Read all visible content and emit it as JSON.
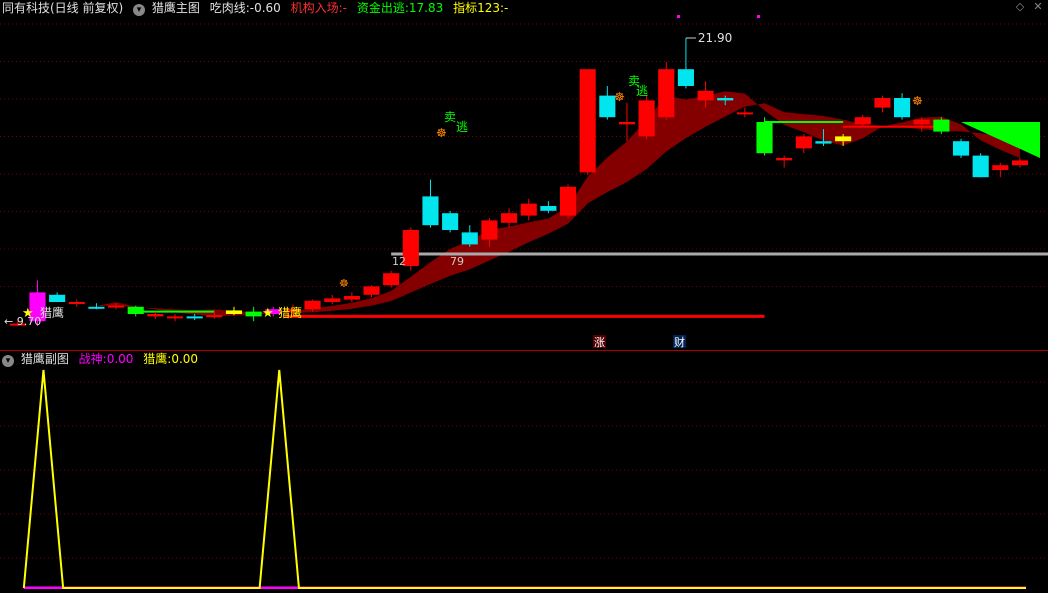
{
  "header": {
    "stock": "同有科技(日线 前复权)",
    "main_title": "猎鹰主图",
    "chirou_label": "吃肉线:",
    "chirou_value": "-0.60",
    "jigou_label": "机构入场:",
    "jigou_value": "-",
    "zijin_label": "资金出逃:",
    "zijin_value": "17.83",
    "zhibiao_label": "指标123:",
    "zhibiao_value": "-"
  },
  "sub_header": {
    "title": "猎鹰副图",
    "zhanshen_label": "战神:",
    "zhanshen_value": "0.00",
    "lieying_label": "猎鹰:",
    "lieying_value": "0.00"
  },
  "annotations": {
    "high": "21.90",
    "low": "9.70",
    "mid_left": "12",
    "mid_right": "79",
    "falcon1": "猎鹰",
    "falcon2": "猎鹰",
    "sell1": "卖",
    "escape1": "逃",
    "sell2": "卖",
    "escape2": "逃",
    "badge_zhang": "涨",
    "badge_cai": "财"
  },
  "colors": {
    "up": "#ff0000",
    "down": "#00e5ee",
    "band": "#8b0000",
    "green": "#00ff00",
    "yellow": "#ffff00",
    "magenta": "#ff00ff",
    "grid": "#7a0000"
  },
  "chart_data": {
    "type": "candlestick",
    "price_range": [
      9.7,
      21.9
    ],
    "candles": [
      {
        "o": 10.0,
        "h": 10.1,
        "l": 9.9,
        "c": 9.95,
        "color": "up"
      },
      {
        "o": 10.1,
        "h": 11.8,
        "l": 9.9,
        "c": 11.3,
        "color": "magenta"
      },
      {
        "o": 11.2,
        "h": 11.3,
        "l": 10.9,
        "c": 10.9,
        "color": "down"
      },
      {
        "o": 10.9,
        "h": 11.0,
        "l": 10.7,
        "c": 10.85,
        "color": "up"
      },
      {
        "o": 10.7,
        "h": 10.85,
        "l": 10.6,
        "c": 10.7,
        "color": "down"
      },
      {
        "o": 10.75,
        "h": 10.85,
        "l": 10.6,
        "c": 10.7,
        "color": "up"
      },
      {
        "o": 10.7,
        "h": 10.75,
        "l": 10.3,
        "c": 10.4,
        "color": "green"
      },
      {
        "o": 10.4,
        "h": 10.5,
        "l": 10.2,
        "c": 10.3,
        "color": "up"
      },
      {
        "o": 10.3,
        "h": 10.4,
        "l": 10.1,
        "c": 10.25,
        "color": "up"
      },
      {
        "o": 10.3,
        "h": 10.4,
        "l": 10.15,
        "c": 10.25,
        "color": "down"
      },
      {
        "o": 10.35,
        "h": 10.5,
        "l": 10.2,
        "c": 10.3,
        "color": "up"
      },
      {
        "o": 10.4,
        "h": 10.7,
        "l": 10.35,
        "c": 10.55,
        "color": "yellow"
      },
      {
        "o": 10.3,
        "h": 10.7,
        "l": 10.1,
        "c": 10.5,
        "color": "green"
      },
      {
        "o": 10.4,
        "h": 10.7,
        "l": 10.3,
        "c": 10.6,
        "color": "magenta"
      },
      {
        "o": 10.5,
        "h": 10.8,
        "l": 10.4,
        "c": 10.6,
        "color": "up"
      },
      {
        "o": 10.6,
        "h": 11.0,
        "l": 10.5,
        "c": 10.95,
        "color": "up"
      },
      {
        "o": 10.9,
        "h": 11.2,
        "l": 10.8,
        "c": 11.05,
        "color": "up"
      },
      {
        "o": 11.0,
        "h": 11.3,
        "l": 10.9,
        "c": 11.15,
        "color": "up"
      },
      {
        "o": 11.2,
        "h": 11.6,
        "l": 11.1,
        "c": 11.55,
        "color": "up"
      },
      {
        "o": 11.6,
        "h": 12.2,
        "l": 11.5,
        "c": 12.1,
        "color": "up"
      },
      {
        "o": 12.4,
        "h": 14.0,
        "l": 12.2,
        "c": 13.9,
        "color": "up"
      },
      {
        "o": 15.3,
        "h": 16.0,
        "l": 14.0,
        "c": 14.1,
        "color": "down"
      },
      {
        "o": 14.6,
        "h": 14.7,
        "l": 13.8,
        "c": 13.9,
        "color": "down"
      },
      {
        "o": 13.8,
        "h": 14.1,
        "l": 13.2,
        "c": 13.3,
        "color": "down"
      },
      {
        "o": 13.5,
        "h": 14.4,
        "l": 13.2,
        "c": 14.3,
        "color": "up"
      },
      {
        "o": 14.2,
        "h": 14.8,
        "l": 14.0,
        "c": 14.6,
        "color": "up"
      },
      {
        "o": 14.5,
        "h": 15.2,
        "l": 14.3,
        "c": 15.0,
        "color": "up"
      },
      {
        "o": 14.9,
        "h": 15.1,
        "l": 14.6,
        "c": 14.7,
        "color": "down"
      },
      {
        "o": 14.5,
        "h": 15.8,
        "l": 14.4,
        "c": 15.7,
        "color": "up"
      },
      {
        "o": 16.3,
        "h": 20.6,
        "l": 16.2,
        "c": 20.6,
        "color": "up"
      },
      {
        "o": 19.5,
        "h": 19.9,
        "l": 18.5,
        "c": 18.6,
        "color": "down"
      },
      {
        "o": 18.4,
        "h": 19.2,
        "l": 17.6,
        "c": 18.3,
        "color": "up"
      },
      {
        "o": 17.8,
        "h": 19.5,
        "l": 17.7,
        "c": 19.3,
        "color": "up"
      },
      {
        "o": 18.6,
        "h": 20.9,
        "l": 18.5,
        "c": 20.6,
        "color": "up"
      },
      {
        "o": 20.6,
        "h": 21.9,
        "l": 19.8,
        "c": 19.9,
        "color": "down"
      },
      {
        "o": 19.7,
        "h": 20.1,
        "l": 19.0,
        "c": 19.3,
        "color": "up"
      },
      {
        "o": 19.4,
        "h": 19.5,
        "l": 19.1,
        "c": 19.3,
        "color": "down"
      },
      {
        "o": 18.8,
        "h": 19.0,
        "l": 18.6,
        "c": 18.8,
        "color": "up"
      },
      {
        "o": 18.4,
        "h": 18.6,
        "l": 17.0,
        "c": 17.1,
        "color": "green"
      },
      {
        "o": 16.8,
        "h": 17.0,
        "l": 16.5,
        "c": 16.9,
        "color": "up"
      },
      {
        "o": 17.3,
        "h": 17.9,
        "l": 17.1,
        "c": 17.8,
        "color": "up"
      },
      {
        "o": 17.6,
        "h": 18.1,
        "l": 17.4,
        "c": 17.5,
        "color": "down"
      },
      {
        "o": 17.6,
        "h": 17.9,
        "l": 17.4,
        "c": 17.8,
        "color": "yellow"
      },
      {
        "o": 18.3,
        "h": 18.7,
        "l": 18.2,
        "c": 18.6,
        "color": "up"
      },
      {
        "o": 19.0,
        "h": 19.5,
        "l": 18.8,
        "c": 19.4,
        "color": "up"
      },
      {
        "o": 19.4,
        "h": 19.6,
        "l": 18.5,
        "c": 18.6,
        "color": "down"
      },
      {
        "o": 18.3,
        "h": 18.6,
        "l": 18.0,
        "c": 18.5,
        "color": "up"
      },
      {
        "o": 18.5,
        "h": 18.6,
        "l": 17.9,
        "c": 18.0,
        "color": "green"
      },
      {
        "o": 17.6,
        "h": 17.7,
        "l": 16.9,
        "c": 17.0,
        "color": "down"
      },
      {
        "o": 17.0,
        "h": 17.1,
        "l": 16.1,
        "c": 16.1,
        "color": "down"
      },
      {
        "o": 16.4,
        "h": 16.7,
        "l": 16.1,
        "c": 16.6,
        "color": "up"
      },
      {
        "o": 16.6,
        "h": 16.9,
        "l": 16.5,
        "c": 16.8,
        "color": "up"
      }
    ],
    "sub_chart": {
      "series": [
        {
          "values": [
            0,
            0,
            0,
            0,
            0,
            0,
            0,
            0,
            0,
            0,
            0,
            0,
            0,
            0,
            0,
            0,
            0,
            0,
            0,
            0,
            0,
            0,
            0,
            0,
            0,
            0,
            0,
            0,
            0,
            0,
            0,
            0,
            0,
            0,
            0,
            0,
            0,
            0,
            0,
            0,
            0,
            0,
            0,
            0,
            0,
            0,
            0,
            0,
            0,
            0,
            0,
            0
          ]
        },
        {
          "values": [
            0,
            1,
            0,
            0,
            0,
            0,
            0,
            0,
            0,
            0,
            0,
            0,
            0,
            1,
            0,
            0,
            0,
            0,
            0,
            0,
            0,
            0,
            0,
            0,
            0,
            0,
            0,
            0,
            0,
            0,
            0,
            0,
            0,
            0,
            0,
            0,
            0,
            0,
            0,
            0,
            0,
            0,
            0,
            0,
            0,
            0,
            0,
            0,
            0,
            0,
            0,
            0
          ]
        }
      ]
    }
  }
}
